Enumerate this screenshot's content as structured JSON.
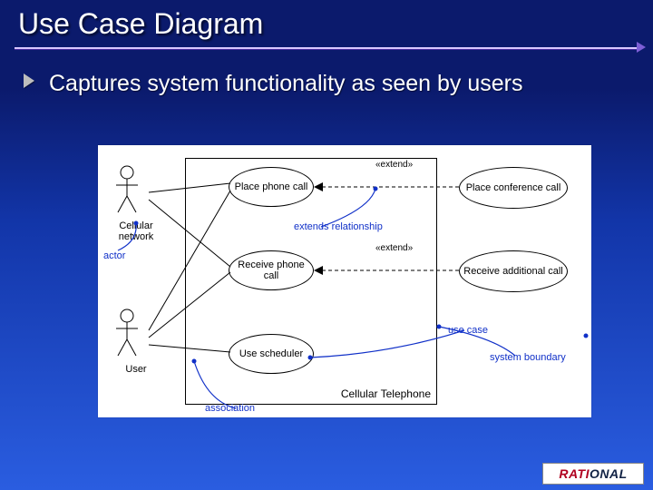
{
  "slide": {
    "title": "Use Case Diagram",
    "bullet": "Captures system functionality as seen by users"
  },
  "diagram": {
    "system_label": "Cellular Telephone",
    "actors": [
      {
        "name": "Cellular network"
      },
      {
        "name": "User"
      }
    ],
    "use_cases": [
      {
        "name": "Place phone call"
      },
      {
        "name": "Receive phone call"
      },
      {
        "name": "Use scheduler"
      },
      {
        "name": "Place conference call"
      },
      {
        "name": "Receive additional call"
      }
    ],
    "relationships": {
      "associations": [
        [
          "Cellular network",
          "Place phone call"
        ],
        [
          "Cellular network",
          "Receive phone call"
        ],
        [
          "User",
          "Place phone call"
        ],
        [
          "User",
          "Receive phone call"
        ],
        [
          "User",
          "Use scheduler"
        ]
      ],
      "extends": [
        {
          "from": "Place conference call",
          "to": "Place phone call",
          "label": "«extend»"
        },
        {
          "from": "Receive additional call",
          "to": "Receive phone call",
          "label": "«extend»"
        }
      ]
    },
    "annotations": {
      "actor": "actor",
      "association": "association",
      "extends_rel": "extends relationship",
      "use_case": "use case",
      "sys_boundary": "system boundary"
    }
  },
  "logo": {
    "part1": "RATI",
    "part2": "ONAL"
  },
  "colors": {
    "curve": "#1030c8",
    "title_rule": "#d8c6ff"
  }
}
